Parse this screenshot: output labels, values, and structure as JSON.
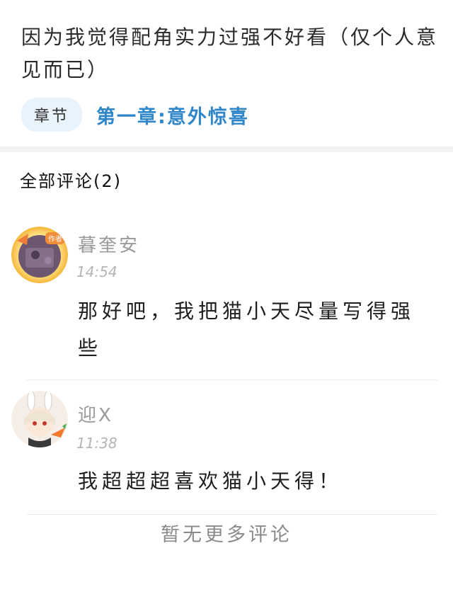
{
  "post": {
    "text": "因为我觉得配角实力过强不好看（仅个人意见而已）"
  },
  "chapter": {
    "badge_label": "章节",
    "link_text": "第一章:意外惊喜"
  },
  "comments_section": {
    "header": "全部评论(2)"
  },
  "comments": [
    {
      "author": "暮奎安",
      "author_badge": "作者",
      "time": "14:54",
      "text": "那好吧，我把猫小天尽量写得强些"
    },
    {
      "author": "迎X",
      "time": "11:38",
      "text": "我超超超喜欢猫小天得！"
    }
  ],
  "footer": {
    "no_more_text": "暂无更多评论"
  }
}
